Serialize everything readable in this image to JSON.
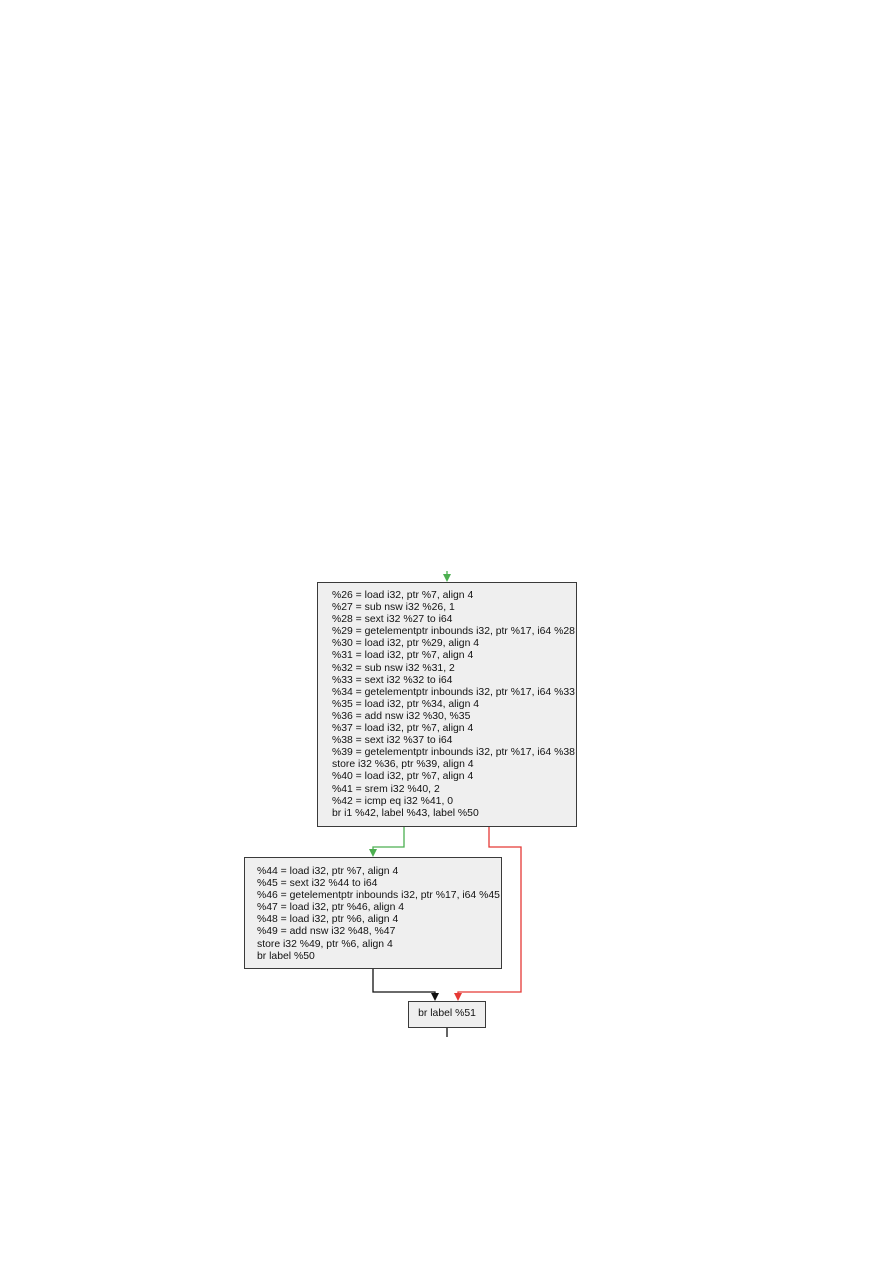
{
  "colors": {
    "true_edge": "#4caf50",
    "false_edge": "#e53935",
    "plain_edge": "#111111",
    "block_fill": "#efefef",
    "block_border": "#3a3a3a"
  },
  "blocks": {
    "entry": {
      "lines": [
        "%26 = load i32, ptr %7, align 4",
        "%27 = sub nsw i32 %26, 1",
        "%28 = sext i32 %27 to i64",
        "%29 = getelementptr inbounds i32, ptr %17, i64 %28",
        "%30 = load i32, ptr %29, align 4",
        "%31 = load i32, ptr %7, align 4",
        "%32 = sub nsw i32 %31, 2",
        "%33 = sext i32 %32 to i64",
        "%34 = getelementptr inbounds i32, ptr %17, i64 %33",
        "%35 = load i32, ptr %34, align 4",
        "%36 = add nsw i32 %30, %35",
        "%37 = load i32, ptr %7, align 4",
        "%38 = sext i32 %37 to i64",
        "%39 = getelementptr inbounds i32, ptr %17, i64 %38",
        "store i32 %36, ptr %39, align 4",
        "%40 = load i32, ptr %7, align 4",
        "%41 = srem i32 %40, 2",
        "%42 = icmp eq i32 %41, 0",
        "br i1 %42, label %43, label %50"
      ]
    },
    "then": {
      "lines": [
        "%44 = load i32, ptr %7, align 4",
        "%45 = sext i32 %44 to i64",
        "%46 = getelementptr inbounds i32, ptr %17, i64 %45",
        "%47 = load i32, ptr %46, align 4",
        "%48 = load i32, ptr %6, align 4",
        "%49 = add nsw i32 %48, %47",
        "store i32 %49, ptr %6, align 4",
        "br label %50"
      ]
    },
    "merge": {
      "lines": [
        "br label %51"
      ]
    }
  }
}
